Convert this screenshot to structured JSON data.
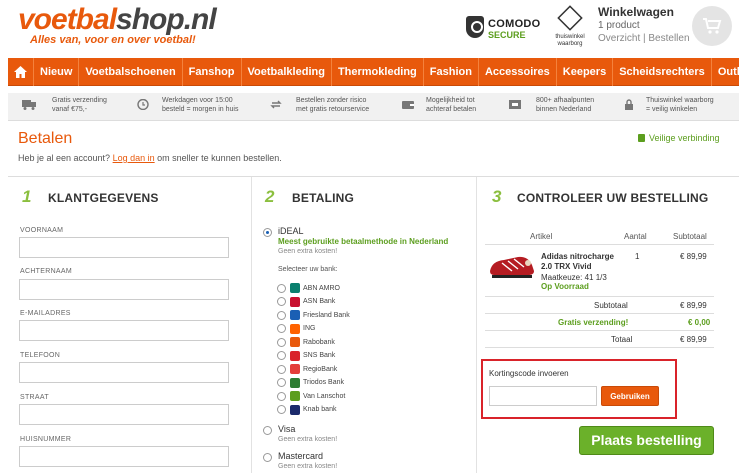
{
  "header": {
    "logo_part1": "voetbal",
    "logo_part2": "shop.nl",
    "tagline": "Alles van, voor en over voetbal!",
    "comodo_line1": "COMODO",
    "comodo_line2": "SECURE",
    "thuiswinkel_text": "thuiswinkel waarborg",
    "cart_title": "Winkelwagen",
    "cart_count": "1 product",
    "cart_links": "Overzicht | Bestellen"
  },
  "nav": {
    "items": [
      "Nieuw",
      "Voetbalschoenen",
      "Fanshop",
      "Voetbalkleding",
      "Thermokleding",
      "Fashion",
      "Accessoires",
      "Keepers",
      "Scheidsrechters",
      "Outlet"
    ]
  },
  "usp": [
    {
      "icon": "truck-icon",
      "l1": "Gratis verzending",
      "l2": "vanaf €75,-"
    },
    {
      "icon": "clock-icon",
      "l1": "Werkdagen voor 15:00",
      "l2": "besteld = morgen in huis"
    },
    {
      "icon": "return-icon",
      "l1": "Bestellen zonder risico",
      "l2": "met gratis retourservice"
    },
    {
      "icon": "wallet-icon",
      "l1": "Mogelijkheid tot",
      "l2": "achteraf betalen"
    },
    {
      "icon": "store-icon",
      "l1": "800+ afhaalpunten",
      "l2": "binnen Nederland"
    },
    {
      "icon": "lock-icon",
      "l1": "Thuiswinkel waarborg",
      "l2": "= veilig winkelen"
    }
  ],
  "page": {
    "title": "Betalen",
    "secure": "Veilige verbinding",
    "account_text": "Heb je al een account?",
    "login_link": "Log dan in",
    "account_text2": "om sneller te kunnen bestellen."
  },
  "customer": {
    "step": "1",
    "title": "KLANTGEGEVENS",
    "fields": [
      "VOORNAAM",
      "ACHTERNAAM",
      "E-MAILADRES",
      "TELEFOON",
      "STRAAT",
      "HUISNUMMER"
    ]
  },
  "payment": {
    "step": "2",
    "title": "BETALING",
    "ideal": "iDEAL",
    "ideal_popular": "Meest gebruikte betaalmethode in Nederland",
    "ideal_sub": "Geen extra kosten!",
    "select_bank": "Selecteer uw bank:",
    "banks": [
      "ABN AMRO",
      "ASN Bank",
      "Friesland Bank",
      "ING",
      "Rabobank",
      "SNS Bank",
      "RegioBank",
      "Triodos Bank",
      "Van Lanschot",
      "Knab bank"
    ],
    "bank_colors": [
      "#0a7f6e",
      "#c8102e",
      "#1a5fb4",
      "#ff6200",
      "#e8590c",
      "#d9232a",
      "#e43d3a",
      "#2e7d32",
      "#5c9e1e",
      "#1b2a6b"
    ],
    "visa": "Visa",
    "visa_sub": "Geen extra kosten!",
    "mastercard": "Mastercard",
    "mastercard_sub": "Geen extra kosten!"
  },
  "order": {
    "step": "3",
    "title": "CONTROLEER UW BESTELLING",
    "col_article": "Artikel",
    "col_qty": "Aantal",
    "col_subtotal": "Subtotaal",
    "product_name": "Adidas nitrocharge 2.0 TRX Vivid",
    "product_size": "Maatkeuze: 41 1/3",
    "product_stock": "Op Voorraad",
    "product_qty": "1",
    "product_price": "€ 89,99",
    "subtotal_label": "Subtotaal",
    "subtotal_value": "€ 89,99",
    "shipping_label": "Gratis verzending!",
    "shipping_value": "€ 0,00",
    "total_label": "Totaal",
    "total_value": "€ 89,99",
    "coupon_label": "Kortingscode invoeren",
    "coupon_button": "Gebruiken",
    "order_button": "Plaats bestelling"
  }
}
